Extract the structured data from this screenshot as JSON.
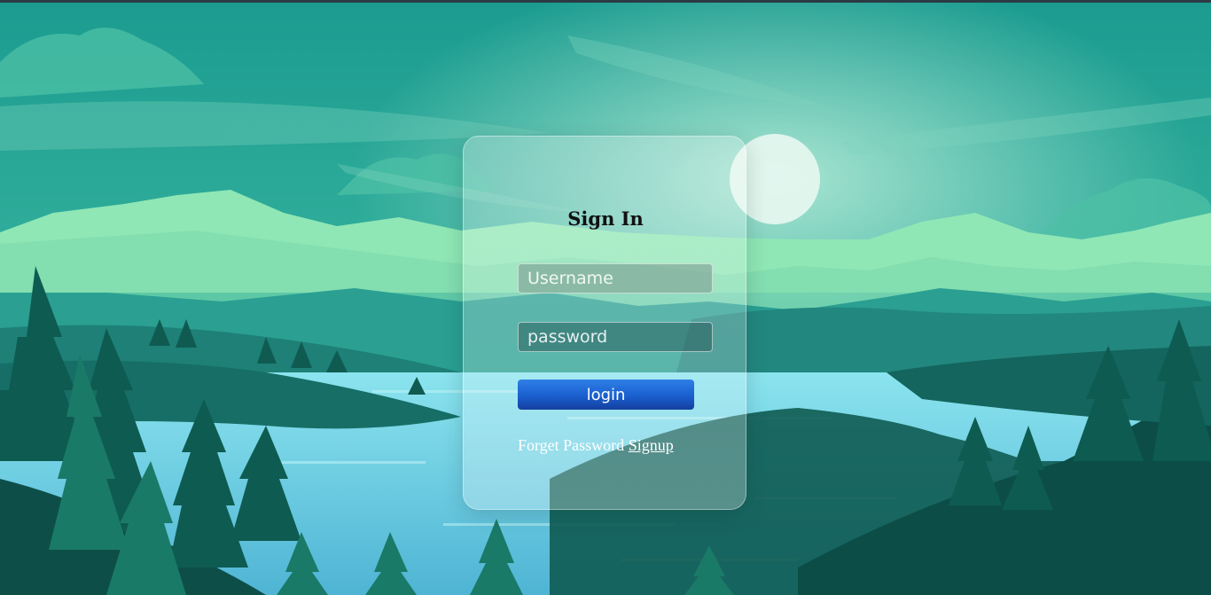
{
  "login_card": {
    "title": "Sign In",
    "username_placeholder": "Username",
    "password_placeholder": "password",
    "login_label": "login",
    "forget_password_label": "Forget Password",
    "signup_label": "Signup"
  },
  "colors": {
    "sky_top": "#1a9a8f",
    "sky_glow": "#7fd3c0",
    "mountains_far": "#8fe7b5",
    "mountains_mid": "#2a9f92",
    "lake": "#6fd6e6",
    "forest_dark": "#0f5b52",
    "button_blue": "#1a5fcf"
  }
}
